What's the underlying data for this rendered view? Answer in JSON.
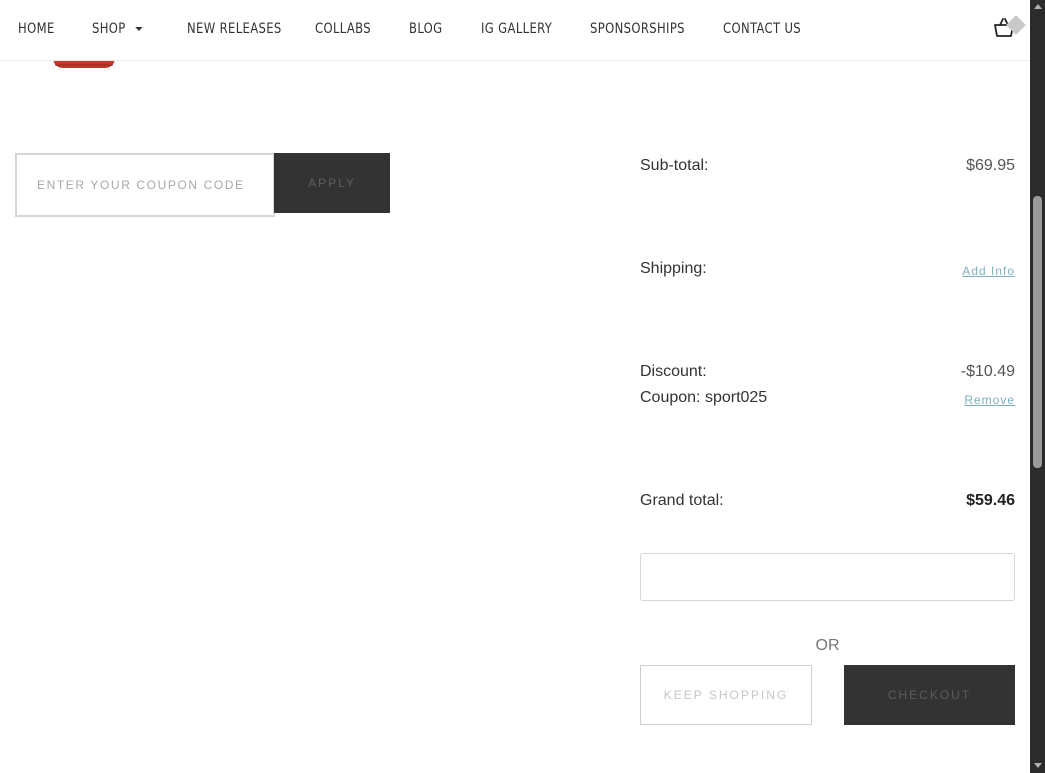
{
  "nav": {
    "items": [
      {
        "label": "HOME"
      },
      {
        "label": "SHOP"
      },
      {
        "label": "NEW RELEASES"
      },
      {
        "label": "COLLABS"
      },
      {
        "label": "BLOG"
      },
      {
        "label": "IG GALLERY"
      },
      {
        "label": "SPONSORSHIPS"
      },
      {
        "label": "CONTACT US"
      }
    ],
    "cart_icon": "basket-icon"
  },
  "coupon": {
    "placeholder": "ENTER YOUR COUPON CODE",
    "apply_label": "APPLY"
  },
  "summary": {
    "subtotal_label": "Sub-total:",
    "subtotal_value": "$69.95",
    "shipping_label": "Shipping:",
    "shipping_link": "Add Info",
    "discount_label": "Discount:",
    "discount_value": "-$10.49",
    "coupon_label": "Coupon: sport025",
    "coupon_remove": "Remove",
    "grand_label": "Grand total:",
    "grand_value": "$59.46"
  },
  "actions": {
    "or_text": "OR",
    "keep_shopping": "KEEP SHOPPING",
    "checkout": "CHECKOUT"
  },
  "colors": {
    "accent_link": "#7fb0c0",
    "button_dark": "#333333",
    "product": "#c0392b"
  }
}
